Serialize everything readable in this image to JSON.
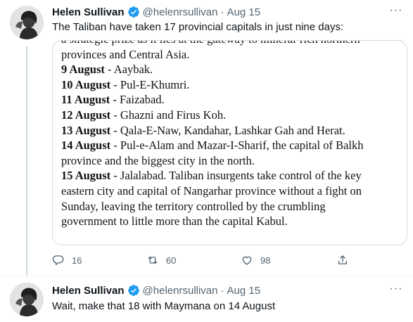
{
  "tweets": [
    {
      "author_name": "Helen Sullivan",
      "handle": "@helenrsullivan",
      "separator": "·",
      "date": "Aug 15",
      "more": "···",
      "text": "The Taliban have taken 17 provincial capitals in just nine days:",
      "media_lines": [
        {
          "date": "",
          "text": "a strategic prize as it lies at the gateway to mineral-rich northern"
        },
        {
          "date": "",
          "text": "provinces and Central Asia."
        },
        {
          "date": "9 August",
          "text": " - Aaybak."
        },
        {
          "date": "10 August",
          "text": " - Pul-E-Khumri."
        },
        {
          "date": "11 August",
          "text": " - Faizabad."
        },
        {
          "date": "12 August",
          "text": " - Ghazni and Firus Koh."
        },
        {
          "date": "13 August",
          "text": " - Qala-E-Naw, Kandahar, Lashkar Gah and Herat."
        },
        {
          "date": "14 August",
          "text": " - Pul-e-Alam and Mazar-I-Sharif, the capital of Balkh"
        },
        {
          "date": "",
          "text": "province and the biggest city in the north."
        },
        {
          "date": "15 August",
          "text": " - Jalalabad. Taliban insurgents take control of the key"
        },
        {
          "date": "",
          "text": "eastern city and capital of Nangarhar province without a fight on"
        },
        {
          "date": "",
          "text": "Sunday, leaving the territory controlled by the crumbling"
        },
        {
          "date": "",
          "text": "government to little more than the capital Kabul."
        }
      ],
      "replies": "16",
      "retweets": "60",
      "likes": "98"
    },
    {
      "author_name": "Helen Sullivan",
      "handle": "@helenrsullivan",
      "separator": "·",
      "date": "Aug 15",
      "more": "···",
      "text": "Wait, make that 18 with Maymana on 14 August"
    }
  ],
  "colors": {
    "verified": "#1d9bf0",
    "secondary_text": "#536471",
    "thread_line": "#cfd9de"
  },
  "icons": [
    "verified-badge-icon",
    "reply-icon",
    "retweet-icon",
    "like-icon",
    "share-icon",
    "more-icon"
  ]
}
